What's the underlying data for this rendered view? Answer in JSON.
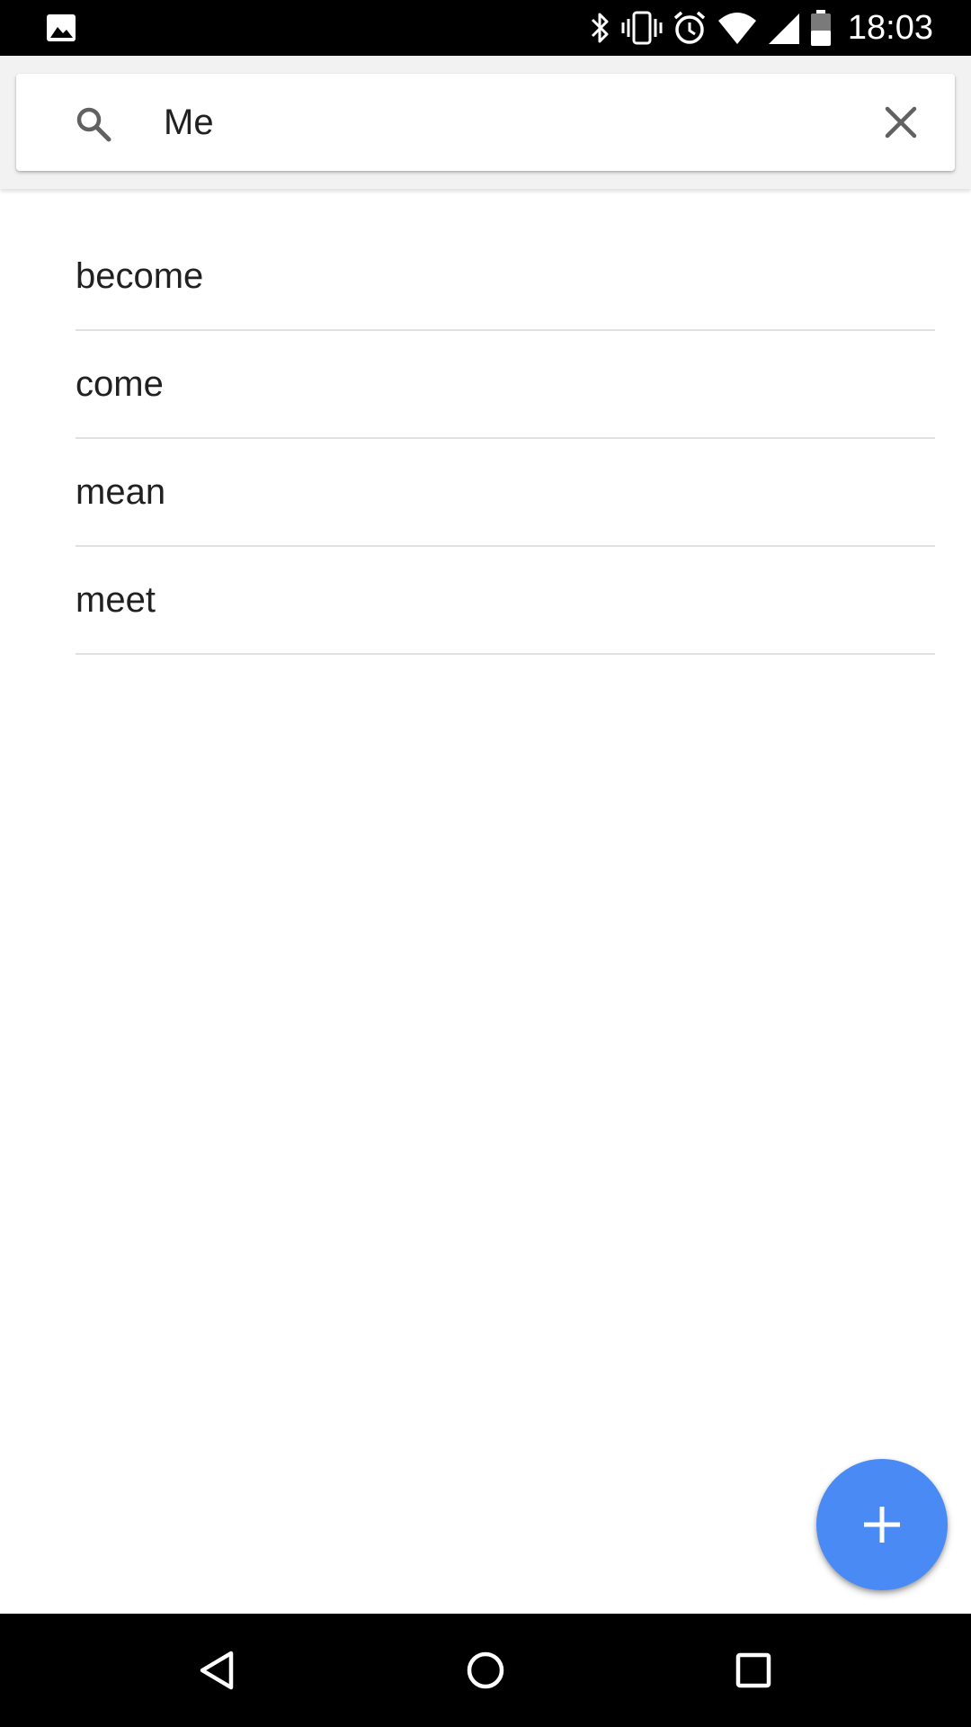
{
  "status_bar": {
    "time": "18:03",
    "icons": [
      "image-icon",
      "bluetooth-icon",
      "vibrate-icon",
      "alarm-icon",
      "wifi-icon",
      "cell-signal-icon",
      "battery-icon"
    ]
  },
  "search": {
    "value": "Me",
    "placeholder": ""
  },
  "results": [
    {
      "label": "become"
    },
    {
      "label": "come"
    },
    {
      "label": "mean"
    },
    {
      "label": "meet"
    }
  ],
  "colors": {
    "fab": "#4a8af4",
    "divider": "#e0e0e0",
    "text": "#212121",
    "icon": "#616161"
  },
  "nav_bar": {
    "icons": [
      "back-icon",
      "home-icon",
      "recents-icon"
    ]
  }
}
